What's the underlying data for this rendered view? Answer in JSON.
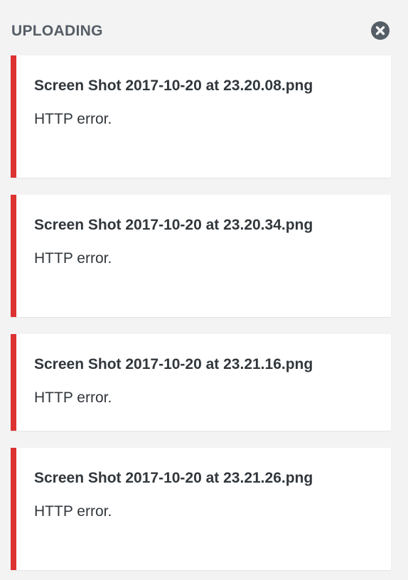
{
  "header": {
    "title": "UPLOADING",
    "close_icon": "close-circle-icon"
  },
  "uploads": [
    {
      "filename": "Screen Shot 2017-10-20 at 23.20.08.png",
      "message": "HTTP error."
    },
    {
      "filename": "Screen Shot 2017-10-20 at 23.20.34.png",
      "message": "HTTP error."
    },
    {
      "filename": "Screen Shot 2017-10-20 at 23.21.16.png",
      "message": "HTTP error."
    },
    {
      "filename": "Screen Shot 2017-10-20 at 23.21.26.png",
      "message": "HTTP error."
    }
  ],
  "colors": {
    "error_accent": "#dc3232",
    "background": "#f3f3f3",
    "card": "#ffffff",
    "header_text": "#555d66"
  }
}
